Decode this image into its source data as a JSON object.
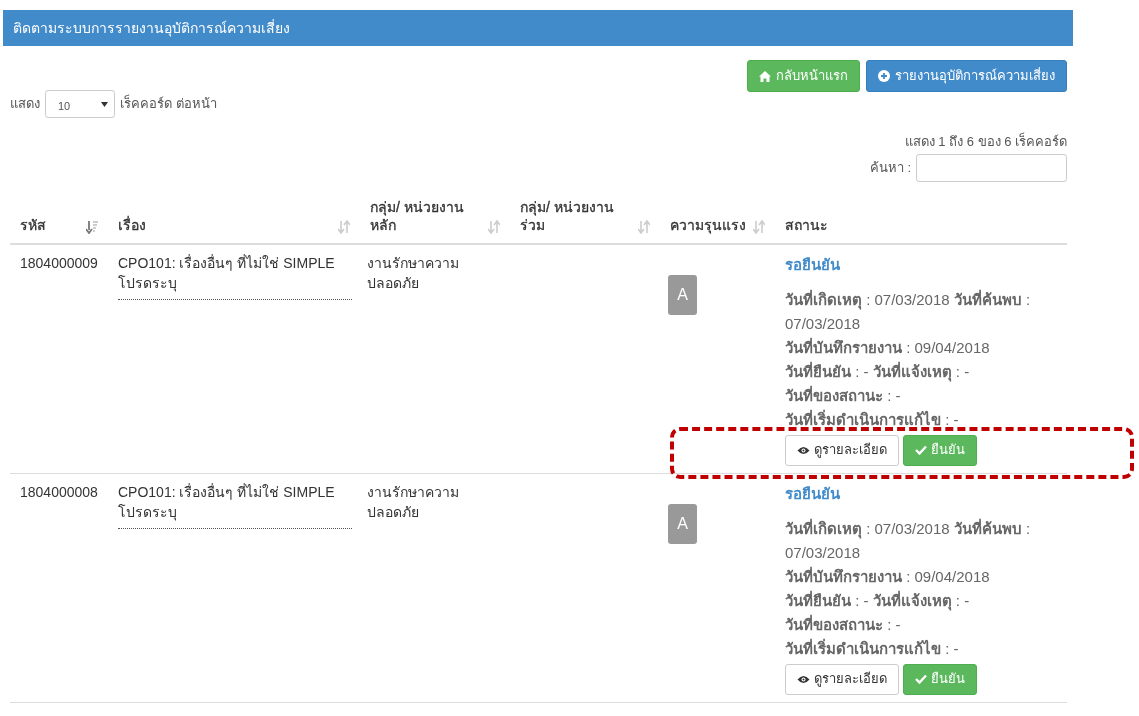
{
  "panel": {
    "title": "ติดตามระบบการรายงานอุบัติการณ์ความเสี่ยง"
  },
  "toolbar": [
    {
      "kind": "home",
      "label": "กลับหน้าแรก"
    },
    {
      "kind": "add",
      "label": "รายงานอุบัติการณ์ความเสี่ยง"
    }
  ],
  "length_menu": {
    "prefix": "แสดง",
    "value": "10",
    "suffix": "เร็คคอร์ด ต่อหน้า"
  },
  "info": "แสดง 1 ถึง 6 ของ 6 เร็คคอร์ด",
  "search": {
    "label": "ค้นหา :"
  },
  "table": {
    "columns": [
      {
        "label": "รหัส",
        "sorted": true
      },
      {
        "label": "เรื่อง",
        "sorted": false
      },
      {
        "label": "กลุ่ม/ หน่วยงานหลัก",
        "sorted": false
      },
      {
        "label": "กลุ่ม/ หน่วยงานร่วม",
        "sorted": false
      },
      {
        "label": "ความรุนแรง",
        "sorted": false
      },
      {
        "label": "สถานะ"
      }
    ],
    "rows": [
      {
        "code": "1804000009",
        "subject": "CPO101: เรื่องอื่นๆ ที่ไม่ใช่ SIMPLE โปรดระบุ",
        "main_group": "งานรักษาความปลอดภัย",
        "severity": "A",
        "status": "รอยืนยัน",
        "details": [
          "**วันที่เกิดเหตุ** : 07/03/2018 **วันที่ค้นพบ** : 07/03/2018",
          "**วันที่บันทึกรายงาน** : 09/04/2018",
          "**วันที่ยืนยัน** : - **วันที่แจ้งเหตุ** : -",
          "**วันที่ของสถานะ** : -",
          "**วันที่เริ่มดำเนินการแก้ไข** : -"
        ],
        "actions": [
          {
            "kind": "view",
            "label": "ดูรายละเอียด"
          },
          {
            "kind": "confirm",
            "label": "ยืนยัน"
          }
        ],
        "highlighted": true
      },
      {
        "code": "1804000008",
        "subject": "CPO101: เรื่องอื่นๆ ที่ไม่ใช่ SIMPLE โปรดระบุ",
        "main_group": "งานรักษาความปลอดภัย",
        "severity": "A",
        "status": "รอยืนยัน",
        "details": [
          "**วันที่เกิดเหตุ** : 07/03/2018 **วันที่ค้นพบ** : 07/03/2018",
          "**วันที่บันทึกรายงาน** : 09/04/2018",
          "**วันที่ยืนยัน** : - **วันที่แจ้งเหตุ** : -",
          "**วันที่ของสถานะ** : -",
          "**วันที่เริ่มดำเนินการแก้ไข** : -"
        ],
        "actions": [
          {
            "kind": "view",
            "label": "ดูรายละเอียด"
          },
          {
            "kind": "confirm",
            "label": "ยืนยัน"
          }
        ],
        "highlighted": false
      }
    ]
  }
}
